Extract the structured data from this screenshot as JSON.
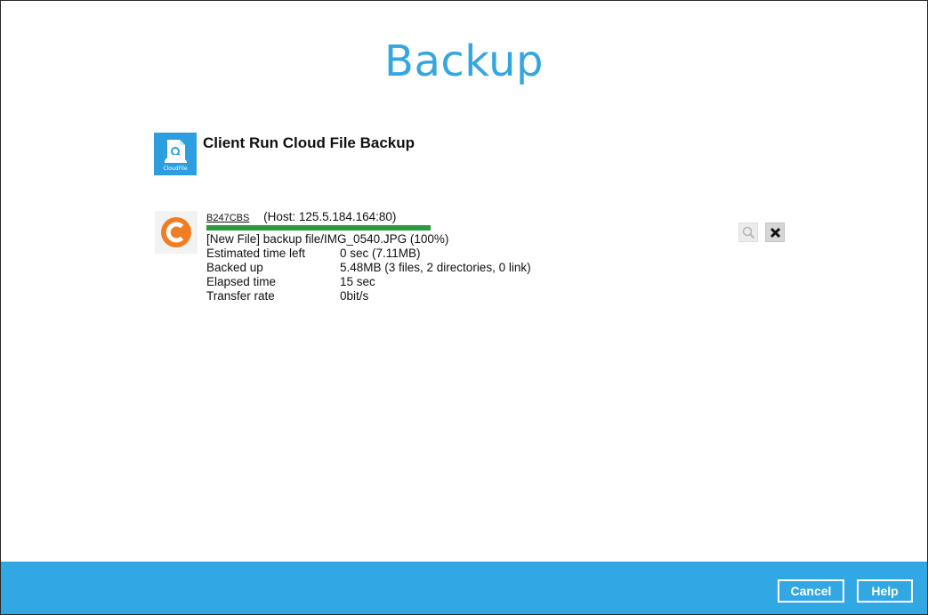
{
  "page": {
    "title": "Backup"
  },
  "job": {
    "icon": "cloud-file-icon",
    "icon_caption": "CloudFile",
    "title": "Client Run Cloud File Backup"
  },
  "progress": {
    "agent_icon": "ahsay-c-icon",
    "host_id": "B247CBS",
    "host_info": "(Host: 125.5.184.164:80)",
    "percent": 100,
    "file_status": "[New File] backup file/IMG_0540.JPG (100%)",
    "stats": [
      {
        "label": "Estimated time left",
        "value": "0 sec (7.11MB)"
      },
      {
        "label": "Backed up",
        "value": "5.48MB (3 files, 2 directories, 0 link)"
      },
      {
        "label": "Elapsed time",
        "value": "15 sec"
      },
      {
        "label": "Transfer rate",
        "value": "0bit/s"
      }
    ],
    "controls": {
      "view_icon": "magnifier-icon",
      "stop_icon": "close-icon",
      "stop_label": "X"
    }
  },
  "footer": {
    "cancel_label": "Cancel",
    "help_label": "Help"
  },
  "colors": {
    "accent": "#35a6e0",
    "footer": "#31a7e4",
    "progress": "#2a9c3e",
    "agent_orange": "#f07d22"
  }
}
